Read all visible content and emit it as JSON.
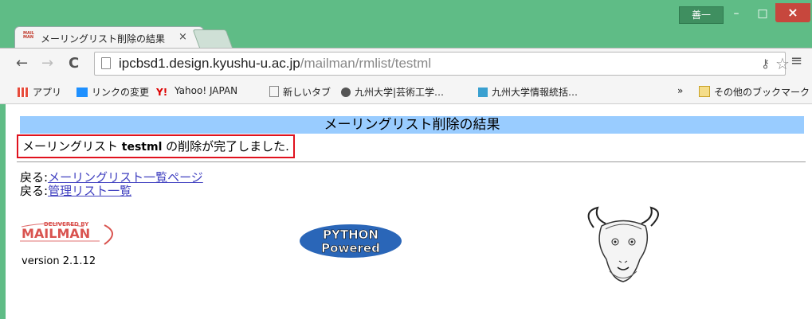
{
  "window": {
    "user_badge": "善一",
    "minimize": "–",
    "maximize": "□",
    "close": "×"
  },
  "tab": {
    "favicon_text": "MAIL MAN",
    "title": "メーリングリスト削除の結果",
    "close": "×"
  },
  "toolbar": {
    "url_host": "ipcbsd1.design.kyushu-u.ac.jp",
    "url_path": "/mailman/rmlist/testml"
  },
  "bookmarks": {
    "apps": "アプリ",
    "item1": "リンクの変更",
    "item2": "Yahoo! JAPAN",
    "item3": "新しいタブ",
    "item4": "九州大学|芸術工学…",
    "item5": "九州大学情報統括…",
    "overflow": "»",
    "other": "その他のブックマーク"
  },
  "page": {
    "banner_title": "メーリングリスト削除の結果",
    "msg_prefix": "メーリングリスト ",
    "msg_list": "testml",
    "msg_suffix": " の削除が完了しました.",
    "back_label": "戻る:",
    "back_link1": "メーリングリスト一覧ページ",
    "back_link2": "管理リスト一覧",
    "mailman_top": "DELIVERED BY",
    "mailman_name": "MAILMAN",
    "version": "version 2.1.12",
    "python_line1": "PYTHON",
    "python_line2": "Powered"
  },
  "colors": {
    "frame": "#5fbc86",
    "banner": "#99ccff",
    "highlight_border": "#e0121e",
    "link": "#4040c0"
  }
}
